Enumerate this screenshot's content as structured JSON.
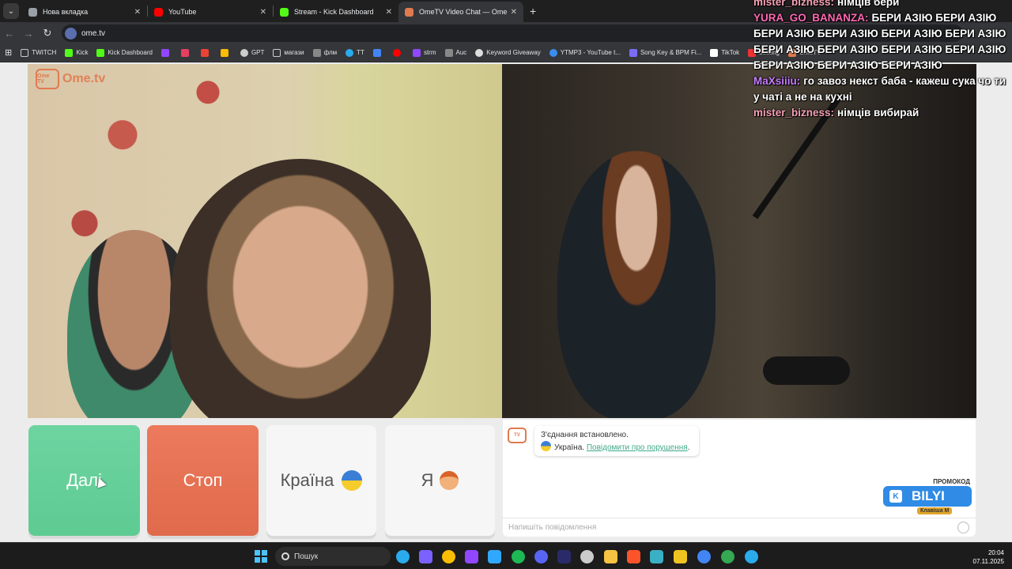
{
  "browser": {
    "tabs": [
      {
        "label": "Нова вкладка",
        "color": "#9aa0a6",
        "active": false
      },
      {
        "label": "YouTube",
        "color": "#ff0000",
        "active": false
      },
      {
        "label": "Stream - Kick Dashboard",
        "color": "#53fc18",
        "active": false
      },
      {
        "label": "OmeTV Video Chat — Ome",
        "color": "#e07a4f",
        "active": true
      }
    ],
    "url": "ome.tv",
    "bookmarks": [
      {
        "label": "TWITCH",
        "color": "#9147ff"
      },
      {
        "label": "Kick",
        "color": "#53fc18"
      },
      {
        "label": "Kick Dashboard",
        "color": "#53fc18"
      },
      {
        "label": "",
        "color": "#9147ff"
      },
      {
        "label": "",
        "color": "#e4405f"
      },
      {
        "label": "",
        "color": "#ea4335"
      },
      {
        "label": "",
        "color": "#fbbc04"
      },
      {
        "label": "GPT",
        "color": "#cccccc"
      },
      {
        "label": "магази",
        "color": "#aaaaaa"
      },
      {
        "label": "флм",
        "color": "#aaaaaa"
      },
      {
        "label": "TT",
        "color": "#2aabee"
      },
      {
        "label": "",
        "color": "#4285f4"
      },
      {
        "label": "",
        "color": "#ff0000"
      },
      {
        "label": "strm",
        "color": "#9147ff"
      },
      {
        "label": "Auc",
        "color": "#aaaaaa"
      },
      {
        "label": "Keyword Giveaway",
        "color": "#dddddd"
      },
      {
        "label": "YTMP3 - YouTube t...",
        "color": "#3a8df0"
      },
      {
        "label": "Song Key & BPM Fi...",
        "color": "#7b6cf6"
      },
      {
        "label": "TikTok",
        "color": "#ffffff"
      },
      {
        "label": "betking",
        "color": "#e33"
      },
      {
        "label": "OmeTV",
        "color": "#e07a4f"
      }
    ]
  },
  "ometv": {
    "logo_text": "Ome.tv",
    "logo_badge": "Ome TV",
    "buttons": {
      "next": "Далі",
      "stop": "Стоп",
      "country": "Країна",
      "me": "Я"
    },
    "chat": {
      "status": "З'єднання встановлено.",
      "country": "Україна.",
      "report": "Повідомити про порушення",
      "report_suffix": ".",
      "placeholder": "Напишіть повідомлення"
    },
    "promo": {
      "title": "ПРОМОКОД",
      "code": "BILYI",
      "key_label": "Клавіша",
      "key": "M"
    }
  },
  "stream_chat": [
    {
      "user": "mister_bizness:",
      "user_color": "#f5a0b5",
      "text": "німців бери"
    },
    {
      "user": "YURA_GO_BANANZA:",
      "user_color": "#ff69b4",
      "text": "БЕРИ АЗІЮ БЕРИ АЗІЮ БЕРИ АЗІЮ БЕРИ АЗІЮ БЕРИ АЗІЮ БЕРИ АЗІЮ БЕРИ АЗІЮ БЕРИ АЗІЮ БЕРИ АЗІЮ БЕРИ АЗІЮ БЕРИ АЗІЮ БЕРИ АЗІЮ БЕРИ АЗІЮ"
    },
    {
      "user": "MaXsiiiu:",
      "user_color": "#c77dff",
      "text": "го завоз некст баба - кажеш сука чо ти у чаті а не на кухні"
    },
    {
      "user": "mister_bizness:",
      "user_color": "#f5a0b5",
      "text": "німців вибирай"
    }
  ],
  "taskbar": {
    "search": "Пошук",
    "time": "20:04",
    "date": "07.11.2025",
    "apps": [
      "telegram",
      "copilot",
      "chrome",
      "twitch",
      "photoshop",
      "spotify",
      "discord",
      "premiere",
      "obs",
      "explorer",
      "brave",
      "davinci",
      "r-app",
      "chrome-2",
      "chrome-3",
      "telegram-2"
    ],
    "app_colors": [
      "#2aabee",
      "#7b61ff",
      "#fbbc04",
      "#9147ff",
      "#31a8ff",
      "#1db954",
      "#5865f2",
      "#9999ff",
      "#cccccc",
      "#f6c343",
      "#fb542b",
      "#3ab0c4",
      "#f0c420",
      "#4285f4",
      "#34a853",
      "#2aabee"
    ]
  }
}
